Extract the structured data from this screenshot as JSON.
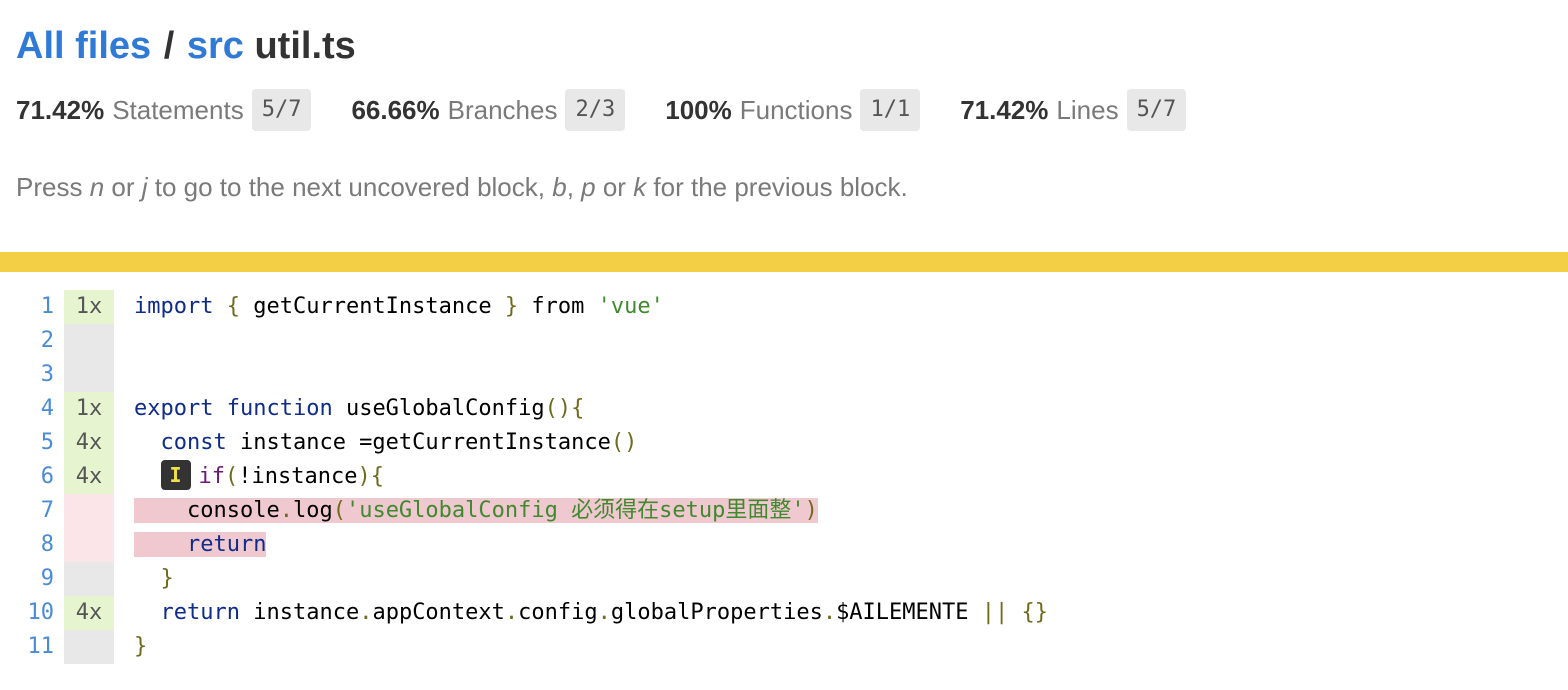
{
  "breadcrumb": {
    "all_files": "All files",
    "separator": "/",
    "folder": "src",
    "file": "util.ts"
  },
  "stats": [
    {
      "pct": "71.42%",
      "label": "Statements",
      "fraction": "5/7"
    },
    {
      "pct": "66.66%",
      "label": "Branches",
      "fraction": "2/3"
    },
    {
      "pct": "100%",
      "label": "Functions",
      "fraction": "1/1"
    },
    {
      "pct": "71.42%",
      "label": "Lines",
      "fraction": "5/7"
    }
  ],
  "hint": {
    "t1": "Press ",
    "k1": "n",
    "t2": " or ",
    "k2": "j",
    "t3": " to go to the next uncovered block, ",
    "k3": "b",
    "t4": ", ",
    "k4": "p",
    "t5": " or ",
    "k5": "k",
    "t6": " for the previous block."
  },
  "colors": {
    "link": "#2f7ad6",
    "status_bar": "#f2cf45",
    "hit": "#e6f5d0",
    "uncovered": "#f0c8cf"
  },
  "badge_label": "I",
  "code": {
    "lines": [
      {
        "n": "1",
        "count": "1x",
        "state": "hit"
      },
      {
        "n": "2",
        "count": "",
        "state": "none"
      },
      {
        "n": "3",
        "count": "",
        "state": "none"
      },
      {
        "n": "4",
        "count": "1x",
        "state": "hit"
      },
      {
        "n": "5",
        "count": "4x",
        "state": "hit"
      },
      {
        "n": "6",
        "count": "4x",
        "state": "hit"
      },
      {
        "n": "7",
        "count": "",
        "state": "miss"
      },
      {
        "n": "8",
        "count": "",
        "state": "miss"
      },
      {
        "n": "9",
        "count": "",
        "state": "none"
      },
      {
        "n": "10",
        "count": "4x",
        "state": "hit"
      },
      {
        "n": "11",
        "count": "",
        "state": "none"
      }
    ],
    "l1": {
      "import": "import",
      "ob": "{",
      "name": " getCurrentInstance ",
      "cb": "}",
      "from": "from",
      "str": "'vue'"
    },
    "l4": {
      "export": "export",
      "function": "function",
      "name": " useGlobalConfig",
      "parens": "(){"
    },
    "l5": {
      "const": "const",
      "rest": " instance =getCurrentInstance",
      "parens": "()"
    },
    "l6": {
      "if": "if",
      "op": "(",
      "rest": "!instance",
      "cp": "){"
    },
    "l7": {
      "obj": "console",
      "dot": ".",
      "method": "log",
      "op": "(",
      "str": "'useGlobalConfig 必须得在setup里面整'",
      "cp": ")"
    },
    "l8": {
      "return": "return"
    },
    "l9": {
      "brace": "}"
    },
    "l10": {
      "return": "return",
      "a": " instance",
      "d1": ".",
      "b": "appContext",
      "d2": ".",
      "c": "config",
      "d3": ".",
      "d": "globalProperties",
      "d4": ".",
      "e": "$AILEMENTE ",
      "or": "||",
      "obj": " {}"
    },
    "l11": {
      "brace": "}"
    }
  }
}
